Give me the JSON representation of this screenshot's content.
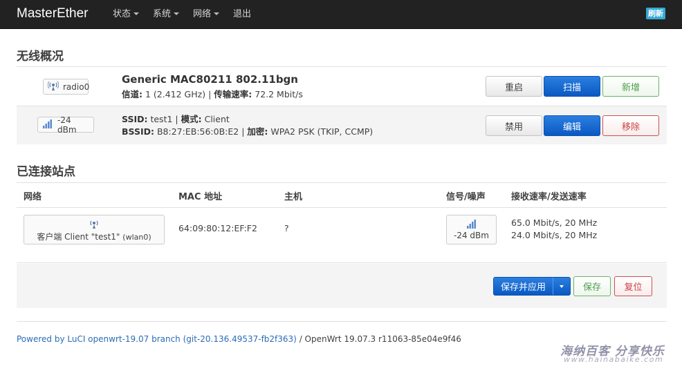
{
  "nav": {
    "brand": "MasterEther",
    "items": [
      "状态",
      "系统",
      "网络",
      "退出"
    ],
    "refresh": "刷新"
  },
  "overview": {
    "title": "无线概况",
    "radio": {
      "badge": "radio0",
      "name": "Generic MAC80211 802.11bgn",
      "channel_label": "信道:",
      "channel_value": "1 (2.412 GHz)",
      "sep": "|",
      "rate_label": "传输速率:",
      "rate_value": "72.2 Mbit/s",
      "buttons": {
        "restart": "重启",
        "scan": "扫描",
        "add": "新增"
      }
    },
    "network": {
      "badge": "-24 dBm",
      "ssid_label": "SSID:",
      "ssid_value": "test1",
      "mode_label": "模式:",
      "mode_value": "Client",
      "bssid_label": "BSSID:",
      "bssid_value": "B8:27:EB:56:0B:E2",
      "enc_label": "加密:",
      "enc_value": "WPA2 PSK (TKIP, CCMP)",
      "buttons": {
        "disable": "禁用",
        "edit": "编辑",
        "remove": "移除"
      }
    }
  },
  "stations": {
    "title": "已连接站点",
    "headers": [
      "网络",
      "MAC 地址",
      "主机",
      "信号/噪声",
      "接收速率/发送速率"
    ],
    "rows": [
      {
        "network": "客户端 Client \"test1\"",
        "iface": "(wlan0)",
        "mac": "64:09:80:12:EF:F2",
        "host": "?",
        "signal": "-24 dBm",
        "rx": "65.0 Mbit/s, 20 MHz",
        "tx": "24.0 Mbit/s, 20 MHz"
      }
    ]
  },
  "actions": {
    "save_apply": "保存并应用",
    "save": "保存",
    "reset": "复位"
  },
  "footer": {
    "link": "Powered by LuCI openwrt-19.07 branch (git-20.136.49537-fb2f363)",
    "rest": " / OpenWrt 19.07.3 r11063-85e04e9f46"
  },
  "watermark": {
    "text": "海纳百客 分享快乐",
    "url": "www.hainabaike.com"
  },
  "colors": {
    "navbar": "#222222",
    "primary": "#0a59c2",
    "positive": "#4b9d4b",
    "negative": "#cc4040",
    "link": "#2a6cb6",
    "badge": "#37a9d6"
  }
}
